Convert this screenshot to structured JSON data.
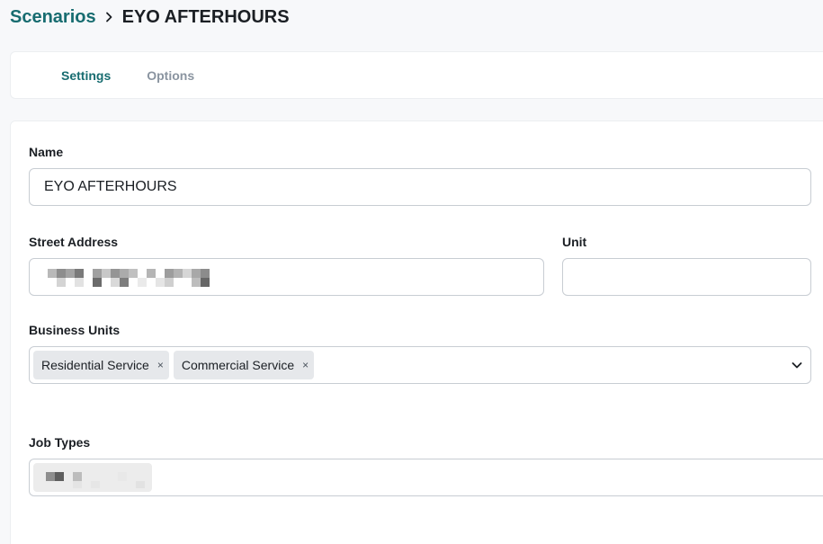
{
  "breadcrumb": {
    "parent": "Scenarios",
    "current": "EYO AFTERHOURS"
  },
  "tabs": [
    {
      "label": "Settings",
      "active": true
    },
    {
      "label": "Options",
      "active": false
    }
  ],
  "form": {
    "name": {
      "label": "Name",
      "value": "EYO AFTERHOURS"
    },
    "street_address": {
      "label": "Street Address",
      "value": "(pixelated)"
    },
    "unit": {
      "label": "Unit",
      "value": ""
    },
    "business_units": {
      "label": "Business Units",
      "selected": [
        "Residential Service",
        "Commercial Service"
      ],
      "remove_glyph": "×"
    },
    "job_types": {
      "label": "Job Types",
      "value": "(pixelated)"
    }
  },
  "icons": {
    "breadcrumb_separator": "chevron-right-icon",
    "dropdown": "chevron-down-icon"
  },
  "colors": {
    "accent": "#176c70",
    "inactive_tab": "#8a94a0",
    "chip_bg": "#e6e8eb",
    "border": "#c8cdd3",
    "background": "#f7f8fa"
  }
}
